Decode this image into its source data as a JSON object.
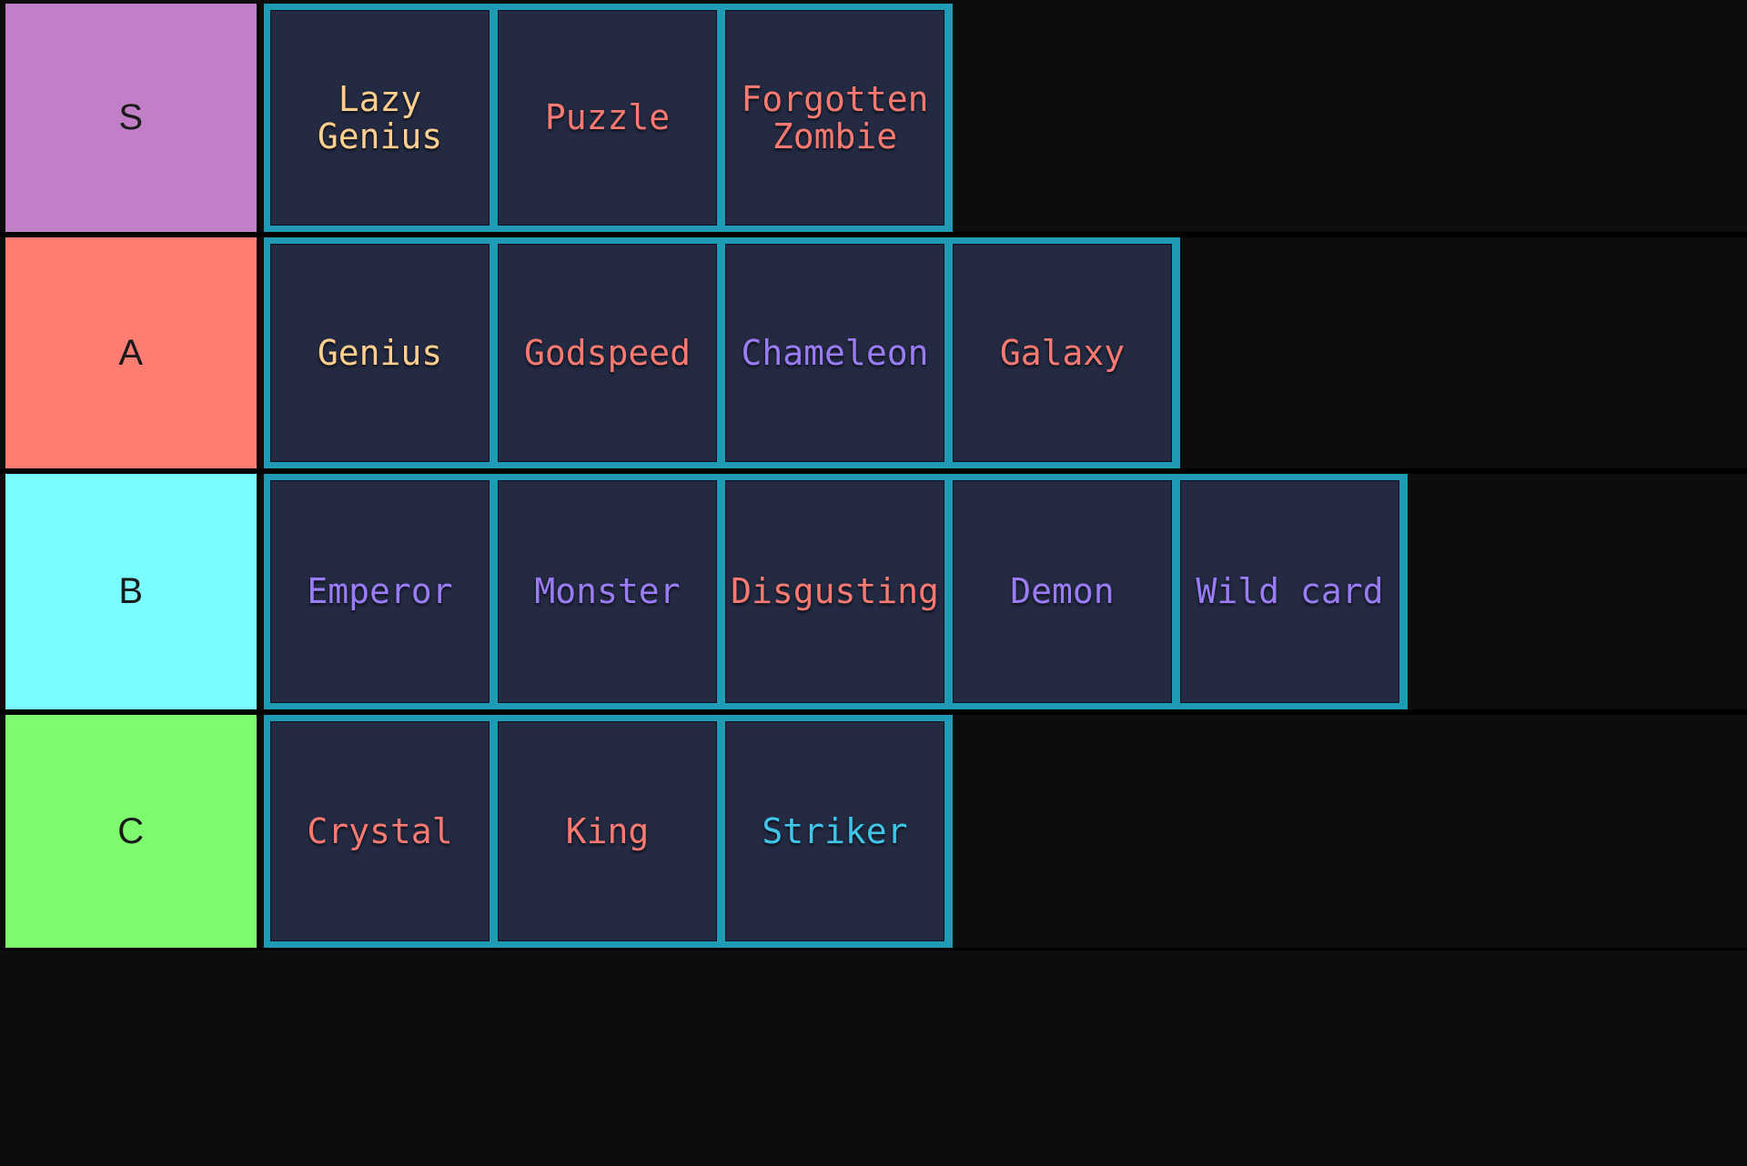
{
  "board": {
    "background_color": "#0d0d0d",
    "card_background_color": "#232a42",
    "card_border_color": "#1f9bb5",
    "separator_color": "#000000"
  },
  "tiers": [
    {
      "label": "S",
      "color": "#c07fc7",
      "cards": [
        {
          "label": "Lazy\nGenius",
          "color": "#ffcf8f"
        },
        {
          "label": "Puzzle",
          "color": "#fa7a72"
        },
        {
          "label": "Forgotten\nZombie",
          "color": "#fa7a72"
        }
      ]
    },
    {
      "label": "A",
      "color": "#fd7d72",
      "cards": [
        {
          "label": "Genius",
          "color": "#ffcf8f"
        },
        {
          "label": "Godspeed",
          "color": "#fa7a72"
        },
        {
          "label": "Chameleon",
          "color": "#9b7cf7"
        },
        {
          "label": "Galaxy",
          "color": "#fa7a72"
        }
      ]
    },
    {
      "label": "B",
      "color": "#7afcff",
      "cards": [
        {
          "label": "Emperor",
          "color": "#9b7cf7"
        },
        {
          "label": "Monster",
          "color": "#9b7cf7"
        },
        {
          "label": "Disgusting",
          "color": "#fa7a72"
        },
        {
          "label": "Demon",
          "color": "#9b7cf7"
        },
        {
          "label": "Wild card",
          "color": "#9b7cf7"
        }
      ]
    },
    {
      "label": "C",
      "color": "#7dfa6e",
      "cards": [
        {
          "label": "Crystal",
          "color": "#fa7a72"
        },
        {
          "label": "King",
          "color": "#fa7a72"
        },
        {
          "label": "Striker",
          "color": "#40c4e8"
        }
      ]
    }
  ]
}
